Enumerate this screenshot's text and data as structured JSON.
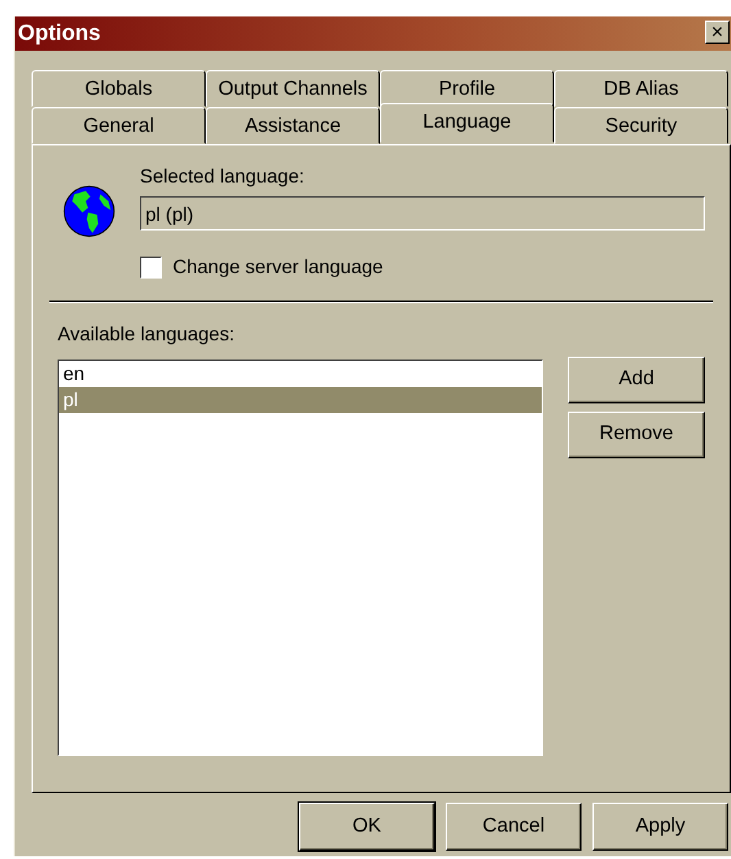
{
  "window": {
    "title": "Options",
    "close": "×"
  },
  "tab_rows": [
    [
      {
        "label": "Globals",
        "selected": false
      },
      {
        "label": "Output Channels",
        "selected": false
      },
      {
        "label": "Profile",
        "selected": false
      },
      {
        "label": "DB Alias",
        "selected": false
      }
    ],
    [
      {
        "label": "General",
        "selected": false
      },
      {
        "label": "Assistance",
        "selected": false
      },
      {
        "label": "Language",
        "selected": true
      },
      {
        "label": "Security",
        "selected": false
      }
    ]
  ],
  "selected_language": {
    "label": "Selected language:",
    "value": "pl (pl)"
  },
  "change_server_language": {
    "label": "Change server language",
    "checked": false
  },
  "available_languages": {
    "label": "Available languages:",
    "items": [
      {
        "label": "en",
        "selected": false
      },
      {
        "label": "pl",
        "selected": true
      }
    ]
  },
  "side_buttons": [
    "Add",
    "Remove"
  ],
  "buttons": [
    "OK",
    "Cancel",
    "Apply"
  ]
}
